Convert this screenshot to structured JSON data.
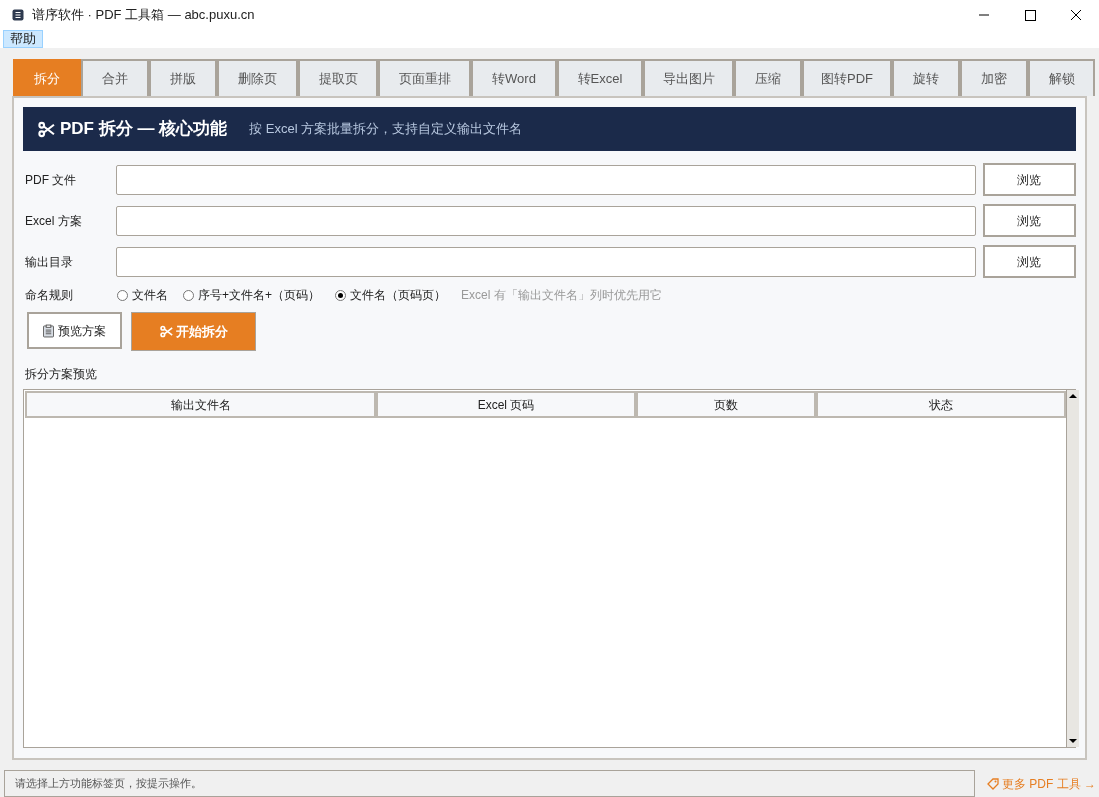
{
  "window": {
    "title": "谱序软件 · PDF 工具箱 — abc.puxu.cn"
  },
  "menu": [
    {
      "label": "帮助",
      "selected": true
    }
  ],
  "tabs": [
    {
      "label": "拆分",
      "selected": true
    },
    {
      "label": "合并",
      "selected": false
    },
    {
      "label": "拼版",
      "selected": false
    },
    {
      "label": "删除页",
      "selected": false
    },
    {
      "label": "提取页",
      "selected": false
    },
    {
      "label": "页面重排",
      "selected": false
    },
    {
      "label": "转Word",
      "selected": false
    },
    {
      "label": "转Excel",
      "selected": false
    },
    {
      "label": "导出图片",
      "selected": false
    },
    {
      "label": "压缩",
      "selected": false
    },
    {
      "label": "图转PDF",
      "selected": false
    },
    {
      "label": "旋转",
      "selected": false
    },
    {
      "label": "加密",
      "selected": false
    },
    {
      "label": "解锁",
      "selected": false
    }
  ],
  "banner": {
    "title": "PDF 拆分 — 核心功能",
    "subtitle": "按 Excel 方案批量拆分，支持自定义输出文件名"
  },
  "fields": [
    {
      "label": "PDF 文件",
      "button": "浏览"
    },
    {
      "label": "Excel 方案",
      "button": "浏览"
    },
    {
      "label": "输出目录",
      "button": "浏览"
    }
  ],
  "naming": {
    "label": "命名规则",
    "options": [
      {
        "label": "文件名",
        "selected": false
      },
      {
        "label": "序号+文件名+（页码）",
        "selected": false
      },
      {
        "label": "文件名（页码页）",
        "selected": true
      }
    ],
    "hint": "Excel 有「输出文件名」列时优先用它"
  },
  "actions": {
    "preview": "预览方案",
    "start": "开始拆分"
  },
  "preview_table": {
    "title": "拆分方案预览",
    "columns": [
      "输出文件名",
      "Excel 页码",
      "页数",
      "状态"
    ]
  },
  "status_bar": {
    "text": "请选择上方功能标签页，按提示操作。",
    "link": "更多 PDF 工具 →"
  }
}
